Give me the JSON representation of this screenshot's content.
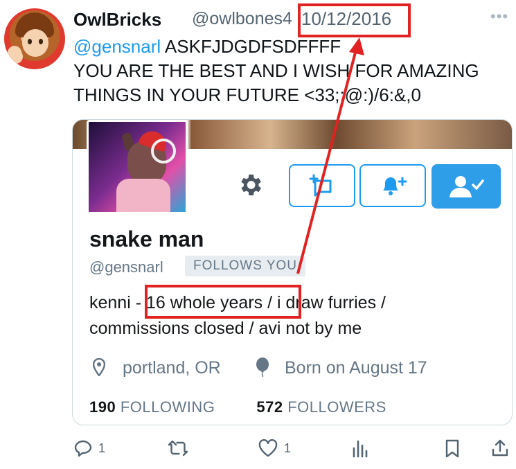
{
  "tweet": {
    "author_name": "OwlBricks",
    "author_handle": "@owlbones4",
    "date": "10/12/2016",
    "more_glyph": "•••",
    "text_mention": "@gensnarl",
    "text_line1_rest": " ASKFJDGDFSDFFFF",
    "text_line2": "YOU ARE THE BEST AND I WISH FOR AMAZING",
    "text_line3": "THINGS IN YOUR FUTURE <33;;@:)/6:&,0"
  },
  "profile_card": {
    "display_name": "snake man",
    "handle": "@gensnarl",
    "follows_badge": "FOLLOWS YOU",
    "bio_pre": "kenni - ",
    "bio_highlight": "16 whole years",
    "bio_post": " / i draw furries /",
    "bio_line2": "commissions closed / avi not by me",
    "location": "portland, OR",
    "birthday": "Born on August 17",
    "following_count": "190",
    "following_label": "FOLLOWING",
    "followers_count": "572",
    "followers_label": "FOLLOWERS"
  },
  "actions": {
    "reply_count": "1",
    "like_count": "1"
  },
  "colors": {
    "accent": "#1d9bf0",
    "annotation_red": "#e02222"
  }
}
